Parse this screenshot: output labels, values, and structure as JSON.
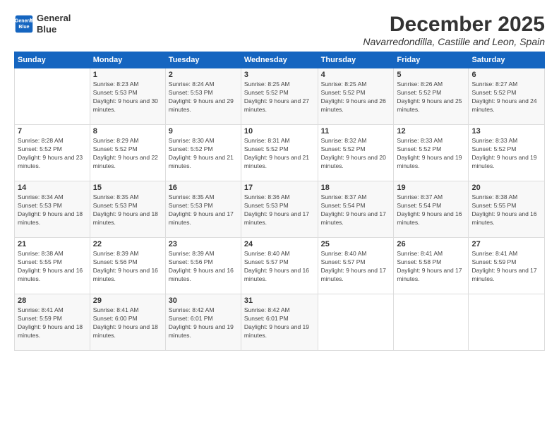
{
  "logo": {
    "line1": "General",
    "line2": "Blue"
  },
  "title": "December 2025",
  "subtitle": "Navarredondilla, Castille and Leon, Spain",
  "header_days": [
    "Sunday",
    "Monday",
    "Tuesday",
    "Wednesday",
    "Thursday",
    "Friday",
    "Saturday"
  ],
  "weeks": [
    [
      {
        "day": "",
        "sunrise": "",
        "sunset": "",
        "daylight": ""
      },
      {
        "day": "1",
        "sunrise": "Sunrise: 8:23 AM",
        "sunset": "Sunset: 5:53 PM",
        "daylight": "Daylight: 9 hours and 30 minutes."
      },
      {
        "day": "2",
        "sunrise": "Sunrise: 8:24 AM",
        "sunset": "Sunset: 5:53 PM",
        "daylight": "Daylight: 9 hours and 29 minutes."
      },
      {
        "day": "3",
        "sunrise": "Sunrise: 8:25 AM",
        "sunset": "Sunset: 5:52 PM",
        "daylight": "Daylight: 9 hours and 27 minutes."
      },
      {
        "day": "4",
        "sunrise": "Sunrise: 8:25 AM",
        "sunset": "Sunset: 5:52 PM",
        "daylight": "Daylight: 9 hours and 26 minutes."
      },
      {
        "day": "5",
        "sunrise": "Sunrise: 8:26 AM",
        "sunset": "Sunset: 5:52 PM",
        "daylight": "Daylight: 9 hours and 25 minutes."
      },
      {
        "day": "6",
        "sunrise": "Sunrise: 8:27 AM",
        "sunset": "Sunset: 5:52 PM",
        "daylight": "Daylight: 9 hours and 24 minutes."
      }
    ],
    [
      {
        "day": "7",
        "sunrise": "Sunrise: 8:28 AM",
        "sunset": "Sunset: 5:52 PM",
        "daylight": "Daylight: 9 hours and 23 minutes."
      },
      {
        "day": "8",
        "sunrise": "Sunrise: 8:29 AM",
        "sunset": "Sunset: 5:52 PM",
        "daylight": "Daylight: 9 hours and 22 minutes."
      },
      {
        "day": "9",
        "sunrise": "Sunrise: 8:30 AM",
        "sunset": "Sunset: 5:52 PM",
        "daylight": "Daylight: 9 hours and 21 minutes."
      },
      {
        "day": "10",
        "sunrise": "Sunrise: 8:31 AM",
        "sunset": "Sunset: 5:52 PM",
        "daylight": "Daylight: 9 hours and 21 minutes."
      },
      {
        "day": "11",
        "sunrise": "Sunrise: 8:32 AM",
        "sunset": "Sunset: 5:52 PM",
        "daylight": "Daylight: 9 hours and 20 minutes."
      },
      {
        "day": "12",
        "sunrise": "Sunrise: 8:33 AM",
        "sunset": "Sunset: 5:52 PM",
        "daylight": "Daylight: 9 hours and 19 minutes."
      },
      {
        "day": "13",
        "sunrise": "Sunrise: 8:33 AM",
        "sunset": "Sunset: 5:52 PM",
        "daylight": "Daylight: 9 hours and 19 minutes."
      }
    ],
    [
      {
        "day": "14",
        "sunrise": "Sunrise: 8:34 AM",
        "sunset": "Sunset: 5:53 PM",
        "daylight": "Daylight: 9 hours and 18 minutes."
      },
      {
        "day": "15",
        "sunrise": "Sunrise: 8:35 AM",
        "sunset": "Sunset: 5:53 PM",
        "daylight": "Daylight: 9 hours and 18 minutes."
      },
      {
        "day": "16",
        "sunrise": "Sunrise: 8:35 AM",
        "sunset": "Sunset: 5:53 PM",
        "daylight": "Daylight: 9 hours and 17 minutes."
      },
      {
        "day": "17",
        "sunrise": "Sunrise: 8:36 AM",
        "sunset": "Sunset: 5:53 PM",
        "daylight": "Daylight: 9 hours and 17 minutes."
      },
      {
        "day": "18",
        "sunrise": "Sunrise: 8:37 AM",
        "sunset": "Sunset: 5:54 PM",
        "daylight": "Daylight: 9 hours and 17 minutes."
      },
      {
        "day": "19",
        "sunrise": "Sunrise: 8:37 AM",
        "sunset": "Sunset: 5:54 PM",
        "daylight": "Daylight: 9 hours and 16 minutes."
      },
      {
        "day": "20",
        "sunrise": "Sunrise: 8:38 AM",
        "sunset": "Sunset: 5:55 PM",
        "daylight": "Daylight: 9 hours and 16 minutes."
      }
    ],
    [
      {
        "day": "21",
        "sunrise": "Sunrise: 8:38 AM",
        "sunset": "Sunset: 5:55 PM",
        "daylight": "Daylight: 9 hours and 16 minutes."
      },
      {
        "day": "22",
        "sunrise": "Sunrise: 8:39 AM",
        "sunset": "Sunset: 5:56 PM",
        "daylight": "Daylight: 9 hours and 16 minutes."
      },
      {
        "day": "23",
        "sunrise": "Sunrise: 8:39 AM",
        "sunset": "Sunset: 5:56 PM",
        "daylight": "Daylight: 9 hours and 16 minutes."
      },
      {
        "day": "24",
        "sunrise": "Sunrise: 8:40 AM",
        "sunset": "Sunset: 5:57 PM",
        "daylight": "Daylight: 9 hours and 16 minutes."
      },
      {
        "day": "25",
        "sunrise": "Sunrise: 8:40 AM",
        "sunset": "Sunset: 5:57 PM",
        "daylight": "Daylight: 9 hours and 17 minutes."
      },
      {
        "day": "26",
        "sunrise": "Sunrise: 8:41 AM",
        "sunset": "Sunset: 5:58 PM",
        "daylight": "Daylight: 9 hours and 17 minutes."
      },
      {
        "day": "27",
        "sunrise": "Sunrise: 8:41 AM",
        "sunset": "Sunset: 5:59 PM",
        "daylight": "Daylight: 9 hours and 17 minutes."
      }
    ],
    [
      {
        "day": "28",
        "sunrise": "Sunrise: 8:41 AM",
        "sunset": "Sunset: 5:59 PM",
        "daylight": "Daylight: 9 hours and 18 minutes."
      },
      {
        "day": "29",
        "sunrise": "Sunrise: 8:41 AM",
        "sunset": "Sunset: 6:00 PM",
        "daylight": "Daylight: 9 hours and 18 minutes."
      },
      {
        "day": "30",
        "sunrise": "Sunrise: 8:42 AM",
        "sunset": "Sunset: 6:01 PM",
        "daylight": "Daylight: 9 hours and 19 minutes."
      },
      {
        "day": "31",
        "sunrise": "Sunrise: 8:42 AM",
        "sunset": "Sunset: 6:01 PM",
        "daylight": "Daylight: 9 hours and 19 minutes."
      },
      {
        "day": "",
        "sunrise": "",
        "sunset": "",
        "daylight": ""
      },
      {
        "day": "",
        "sunrise": "",
        "sunset": "",
        "daylight": ""
      },
      {
        "day": "",
        "sunrise": "",
        "sunset": "",
        "daylight": ""
      }
    ]
  ]
}
